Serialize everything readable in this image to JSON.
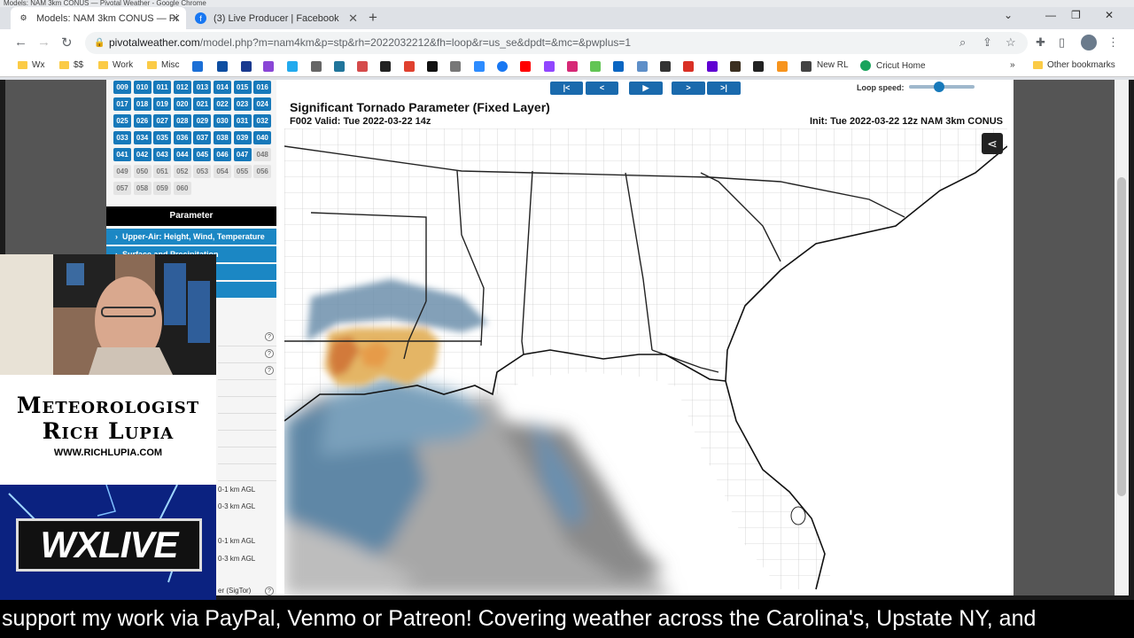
{
  "window_title": "Models: NAM 3km CONUS — Pivotal Weather - Google Chrome",
  "tabs": [
    {
      "label": "Models: NAM 3km CONUS — Pi",
      "active": true
    },
    {
      "label": "(3) Live Producer | Facebook",
      "active": false
    }
  ],
  "address": {
    "host": "pivotalweather.com",
    "path": "/model.php?m=nam4km&p=stp&rh=2022032212&fh=loop&r=us_se&dpdt=&mc=&pwplus=1"
  },
  "bookmarks": {
    "folders": [
      "Wx",
      "$$",
      "Work",
      "Misc"
    ],
    "named": [
      "New RL",
      "Cricut Home"
    ],
    "other": "Other bookmarks",
    "overflow": "»"
  },
  "forecast_hours": [
    {
      "label": "009",
      "available": true
    },
    {
      "label": "010",
      "available": true
    },
    {
      "label": "011",
      "available": true
    },
    {
      "label": "012",
      "available": true
    },
    {
      "label": "013",
      "available": true
    },
    {
      "label": "014",
      "available": true
    },
    {
      "label": "015",
      "available": true
    },
    {
      "label": "016",
      "available": true
    },
    {
      "label": "017",
      "available": true
    },
    {
      "label": "018",
      "available": true
    },
    {
      "label": "019",
      "available": true
    },
    {
      "label": "020",
      "available": true
    },
    {
      "label": "021",
      "available": true
    },
    {
      "label": "022",
      "available": true
    },
    {
      "label": "023",
      "available": true
    },
    {
      "label": "024",
      "available": true
    },
    {
      "label": "025",
      "available": true
    },
    {
      "label": "026",
      "available": true
    },
    {
      "label": "027",
      "available": true
    },
    {
      "label": "028",
      "available": true
    },
    {
      "label": "029",
      "available": true
    },
    {
      "label": "030",
      "available": true
    },
    {
      "label": "031",
      "available": true
    },
    {
      "label": "032",
      "available": true
    },
    {
      "label": "033",
      "available": true
    },
    {
      "label": "034",
      "available": true
    },
    {
      "label": "035",
      "available": true
    },
    {
      "label": "036",
      "available": true
    },
    {
      "label": "037",
      "available": true
    },
    {
      "label": "038",
      "available": true
    },
    {
      "label": "039",
      "available": true
    },
    {
      "label": "040",
      "available": true
    },
    {
      "label": "041",
      "available": true
    },
    {
      "label": "042",
      "available": true
    },
    {
      "label": "043",
      "available": true
    },
    {
      "label": "044",
      "available": true
    },
    {
      "label": "045",
      "available": true
    },
    {
      "label": "046",
      "available": true
    },
    {
      "label": "047",
      "available": true
    },
    {
      "label": "048",
      "available": false
    },
    {
      "label": "049",
      "available": false
    },
    {
      "label": "050",
      "available": false
    },
    {
      "label": "051",
      "available": false
    },
    {
      "label": "052",
      "available": false
    },
    {
      "label": "053",
      "available": false
    },
    {
      "label": "054",
      "available": false
    },
    {
      "label": "055",
      "available": false
    },
    {
      "label": "056",
      "available": false
    },
    {
      "label": "057",
      "available": false
    },
    {
      "label": "058",
      "available": false
    },
    {
      "label": "059",
      "available": false
    },
    {
      "label": "060",
      "available": false
    }
  ],
  "parameter": {
    "heading": "Parameter",
    "categories": [
      "Upper-Air: Height, Wind, Temperature",
      "Surface and Precipitation"
    ],
    "partial_items": [
      "0-1 km AGL",
      "0-3 km AGL",
      "0-1 km AGL",
      "0-3 km AGL",
      "er (SigTor)"
    ]
  },
  "loop": {
    "buttons": [
      "|<",
      "<",
      "▶",
      ">",
      ">|"
    ],
    "speed_label": "Loop speed:",
    "speed": 0.45
  },
  "map": {
    "title": "Significant Tornado Parameter (Fixed Layer)",
    "valid": "F002 Valid: Tue 2022-03-22 14z",
    "init": "Init: Tue 2022-03-22 12z NAM 3km CONUS"
  },
  "overlay": {
    "line1": "Meteorologist",
    "line2": "Rich Lupia",
    "url": "WWW.RICHLUPIA.COM",
    "logo": "WXLIVE"
  },
  "ticker": "support my work via PayPal, Venmo or Patreon! Covering weather across the Carolina's, Upstate NY, and",
  "colors": {
    "accent": "#1779ba",
    "param_bar": "#1b87c4",
    "loop_btn": "#1a6aad"
  }
}
